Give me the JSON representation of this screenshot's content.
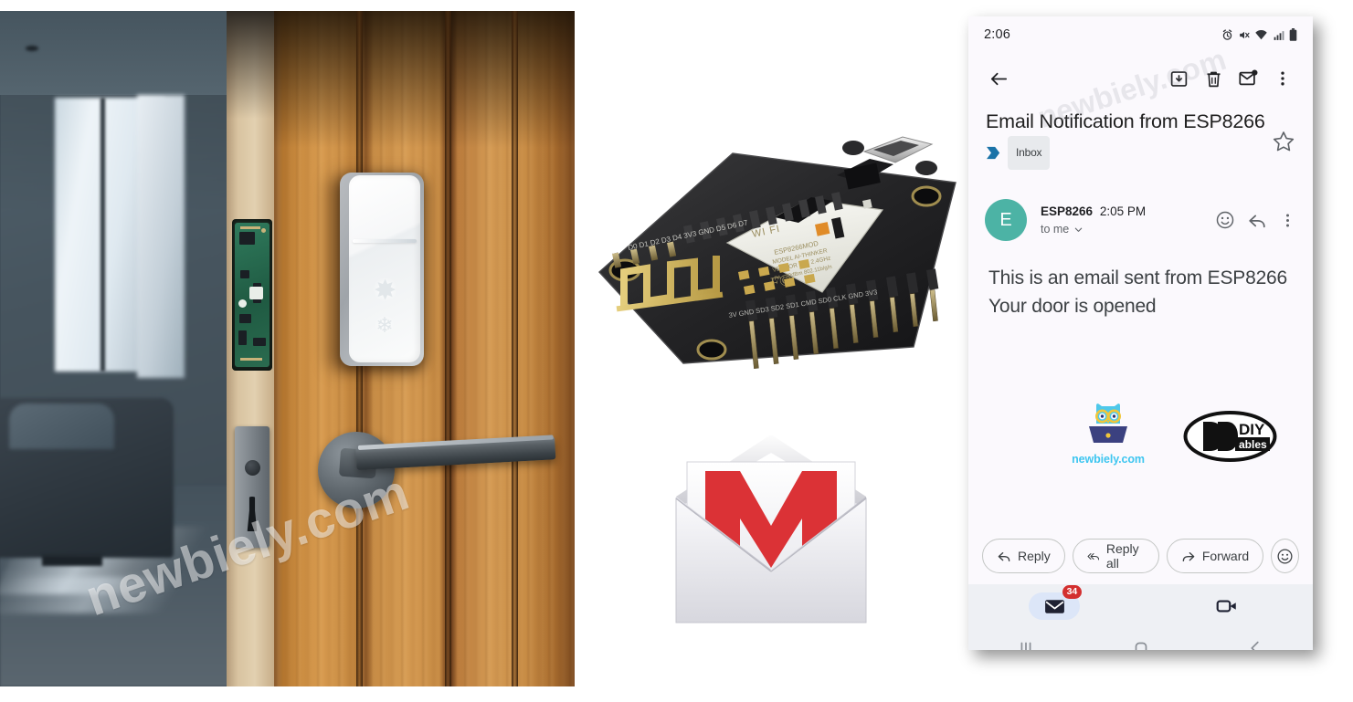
{
  "left_photo": {
    "name": "smart-door-lock-photo",
    "watermark": "newbiely.com",
    "alt": "Wooden door with smart lock and door sensor, room interior visible"
  },
  "middle": {
    "board": {
      "name": "esp8266-nodemcu-board",
      "labels": [
        "WIFI",
        "ESP8266MOD",
        "AI-THINKER",
        "MODEL",
        "VENDOR"
      ]
    },
    "gmail": {
      "name": "gmail-envelope-logo",
      "letter": "M"
    }
  },
  "phone": {
    "status": {
      "time": "2:06",
      "icons": [
        "alarm-icon",
        "mute-icon",
        "wifi-icon",
        "signal-icon",
        "battery-icon"
      ]
    },
    "app_bar": {
      "back": "back-arrow-icon",
      "archive": "archive-icon",
      "delete": "trash-icon",
      "unread": "mark-unread-icon",
      "more": "more-vert-icon"
    },
    "email": {
      "subject": "Email Notification from ESP8266",
      "label_chip": "Inbox",
      "star": "star-outline-icon",
      "avatar_letter": "E",
      "sender": "ESP8266",
      "time": "2:05 PM",
      "recipient": "to me",
      "body_lines": [
        "This is an email sent from ESP8266",
        "Your door is opened"
      ],
      "actions": {
        "emoji": "emoji-icon",
        "reply": "reply-icon",
        "more": "more-vert-icon"
      }
    },
    "logos": {
      "newbiely_text": "newbiely.com",
      "diyables_line1": "DIY",
      "diyables_line2": "ables"
    },
    "reply_bar": {
      "reply": "Reply",
      "reply_all": "Reply all",
      "forward": "Forward",
      "emoji": "emoji-icon"
    },
    "bottom_nav": {
      "mail_badge": "34",
      "mail_icon": "mail-icon",
      "meet_icon": "video-camera-icon"
    },
    "system_nav": {
      "recents": "recents-icon",
      "home": "home-icon",
      "back": "back-icon"
    },
    "watermark": "newbiely.com"
  },
  "colors": {
    "accent_teal": "#4cb3a5",
    "badge_red": "#d32f2f",
    "chip_gray": "#e8eaed",
    "nav_bg": "#eef0f4",
    "tab_pill": "#dce6f8",
    "newbiely_blue": "#3ec6f0",
    "gmail_red": "#db3236"
  }
}
